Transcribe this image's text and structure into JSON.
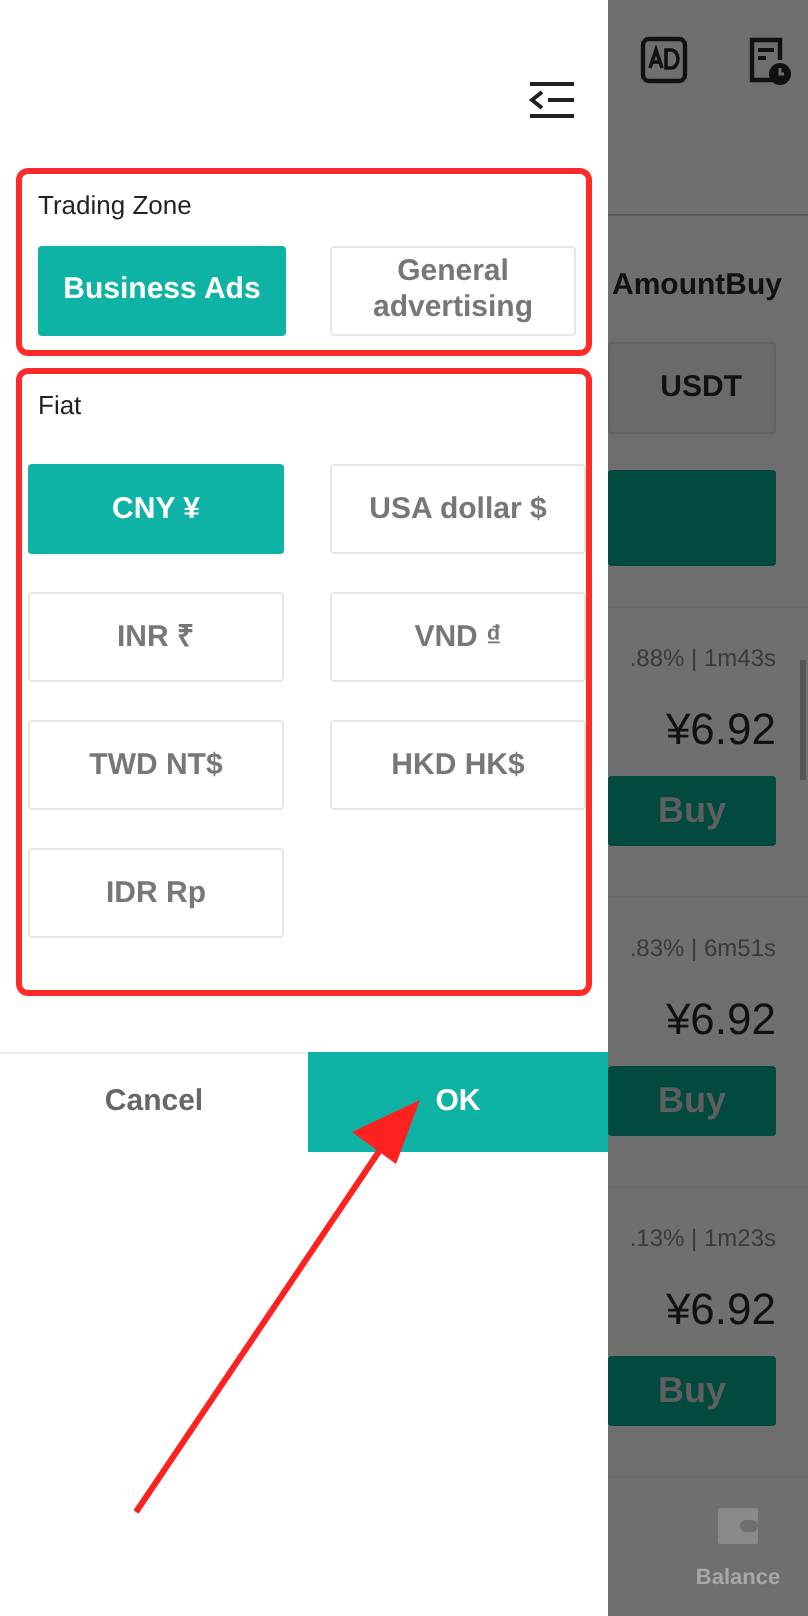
{
  "drawer": {
    "sections": [
      {
        "title": "Trading Zone",
        "options": [
          {
            "label": "Business Ads",
            "selected": true
          },
          {
            "label": "General advertising",
            "selected": false
          }
        ]
      },
      {
        "title": "Fiat",
        "options": [
          {
            "label": "CNY ¥",
            "selected": true
          },
          {
            "label": "USA dollar $",
            "selected": false
          },
          {
            "label": "INR ₹",
            "selected": false
          },
          {
            "label": "VND ₫",
            "selected": false
          },
          {
            "label": "TWD NT$",
            "selected": false
          },
          {
            "label": "HKD HK$",
            "selected": false
          },
          {
            "label": "IDR Rp",
            "selected": false
          }
        ]
      }
    ],
    "buttons": [
      {
        "label": "Cancel",
        "kind": "secondary"
      },
      {
        "label": "OK",
        "kind": "primary"
      }
    ]
  },
  "background": {
    "column_header": "AmountBuy",
    "currency": "USDT",
    "offers": [
      {
        "stats": ".88% | 1m43s",
        "price": "¥6.92",
        "action": "Buy"
      },
      {
        "stats": ".83% | 6m51s",
        "price": "¥6.92",
        "action": "Buy"
      },
      {
        "stats": ".13% | 1m23s",
        "price": "¥6.92",
        "action": "Buy"
      }
    ],
    "nav_label": "Balance"
  }
}
